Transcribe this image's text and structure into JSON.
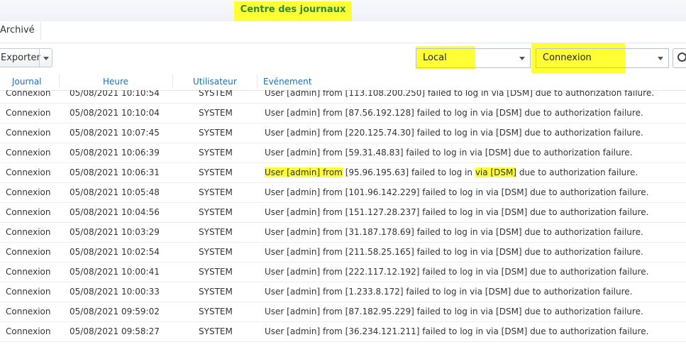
{
  "window": {
    "title": "Centre des journaux"
  },
  "tabs": [
    {
      "label": "Archivé"
    }
  ],
  "toolbar": {
    "export_label": "Exporter",
    "source_select": "Local",
    "type_select": "Connexion"
  },
  "columns": {
    "journal": "Journal",
    "heure": "Heure",
    "utilisateur": "Utilisateur",
    "evenement": "Evénement"
  },
  "rows": [
    {
      "journal": "Connexion",
      "heure": "05/08/2021 10:10:54",
      "user": "SYSTEM",
      "event": "User [admin] from [113.108.200.250] failed to log in via [DSM] due to authorization failure."
    },
    {
      "journal": "Connexion",
      "heure": "05/08/2021 10:10:04",
      "user": "SYSTEM",
      "event": "User [admin] from [87.56.192.128] failed to log in via [DSM] due to authorization failure."
    },
    {
      "journal": "Connexion",
      "heure": "05/08/2021 10:07:45",
      "user": "SYSTEM",
      "event": "User [admin] from [220.125.74.30] failed to log in via [DSM] due to authorization failure."
    },
    {
      "journal": "Connexion",
      "heure": "05/08/2021 10:06:39",
      "user": "SYSTEM",
      "event": "User [admin] from [59.31.48.83] failed to log in via [DSM] due to authorization failure."
    },
    {
      "journal": "Connexion",
      "heure": "05/08/2021 10:06:31",
      "user": "SYSTEM",
      "event_parts": [
        "User [admin] from",
        " [95.96.195.63] failed to log in ",
        "via [DSM]",
        " due to authorization failure."
      ]
    },
    {
      "journal": "Connexion",
      "heure": "05/08/2021 10:05:48",
      "user": "SYSTEM",
      "event": "User [admin] from [101.96.142.229] failed to log in via [DSM] due to authorization failure."
    },
    {
      "journal": "Connexion",
      "heure": "05/08/2021 10:04:56",
      "user": "SYSTEM",
      "event": "User [admin] from [151.127.28.237] failed to log in via [DSM] due to authorization failure."
    },
    {
      "journal": "Connexion",
      "heure": "05/08/2021 10:03:29",
      "user": "SYSTEM",
      "event": "User [admin] from [31.187.178.69] failed to log in via [DSM] due to authorization failure."
    },
    {
      "journal": "Connexion",
      "heure": "05/08/2021 10:02:54",
      "user": "SYSTEM",
      "event": "User [admin] from [211.58.25.165] failed to log in via [DSM] due to authorization failure."
    },
    {
      "journal": "Connexion",
      "heure": "05/08/2021 10:00:41",
      "user": "SYSTEM",
      "event": "User [admin] from [222.117.12.192] failed to log in via [DSM] due to authorization failure."
    },
    {
      "journal": "Connexion",
      "heure": "05/08/2021 10:00:33",
      "user": "SYSTEM",
      "event": "User [admin] from [1.233.8.172] failed to log in via [DSM] due to authorization failure."
    },
    {
      "journal": "Connexion",
      "heure": "05/08/2021 09:59:02",
      "user": "SYSTEM",
      "event": "User [admin] from [87.182.95.229] failed to log in via [DSM] due to authorization failure."
    },
    {
      "journal": "Connexion",
      "heure": "05/08/2021 09:58:27",
      "user": "SYSTEM",
      "event": "User [admin] from [36.234.121.211] failed to log in via [DSM] due to authorization failure."
    }
  ],
  "colors": {
    "highlight": "#ffff33",
    "title_text": "#2e8b3a",
    "header_text": "#1f6fb5"
  },
  "icons": {
    "search": "search-icon",
    "dropdown": "chevron-down-icon"
  }
}
